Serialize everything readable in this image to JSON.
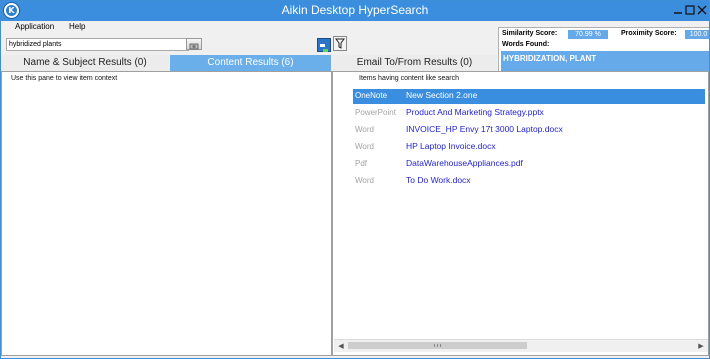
{
  "window": {
    "title": "Aikin Desktop HyperSearch",
    "icon": "app-logo-icon"
  },
  "window_controls": [
    "minimize-icon",
    "maximize-icon",
    "close-icon"
  ],
  "menu": {
    "items": [
      "Application",
      "Help"
    ]
  },
  "search": {
    "value": "hybridized plants",
    "button_icon": "search-icon"
  },
  "toolbar": {
    "icons": [
      "highlight-toggle-icon",
      "filter-icon"
    ]
  },
  "scores": {
    "similarity_label": "Similarity Score:",
    "similarity_value": "70.99 %",
    "proximity_label": "Proximity Score:",
    "proximity_value": "100.0",
    "words_found_label": "Words Found:",
    "words_found_value": "HYBRIDIZATION, PLANT"
  },
  "tabs": [
    {
      "label": "Name & Subject Results (0)",
      "active": false
    },
    {
      "label": "Content Results (6)",
      "active": true
    },
    {
      "label": "Email To/From Results (0)",
      "active": false
    }
  ],
  "left_pane": {
    "hint": "Use this pane to view item context"
  },
  "results_pane": {
    "hint": "Items having content like search",
    "rows": [
      {
        "type": "OneNote",
        "name": "New Section 2.one",
        "selected": true
      },
      {
        "type": "PowerPoint",
        "name": "Product And Marketing Strategy.pptx",
        "selected": false
      },
      {
        "type": "Word",
        "name": "INVOICE_HP Envy 17t 3000 Laptop.docx",
        "selected": false
      },
      {
        "type": "Word",
        "name": "HP Laptop Invoice.docx",
        "selected": false
      },
      {
        "type": "Pdf",
        "name": "DataWarehouseAppliances.pdf",
        "selected": false
      },
      {
        "type": "Word",
        "name": "To Do Work.docx",
        "selected": false
      }
    ]
  },
  "colors": {
    "titlebar": "#3b8ede",
    "accent": "#67aaea",
    "link": "#1f1fd4",
    "selected_row": "#3a8ee0"
  }
}
